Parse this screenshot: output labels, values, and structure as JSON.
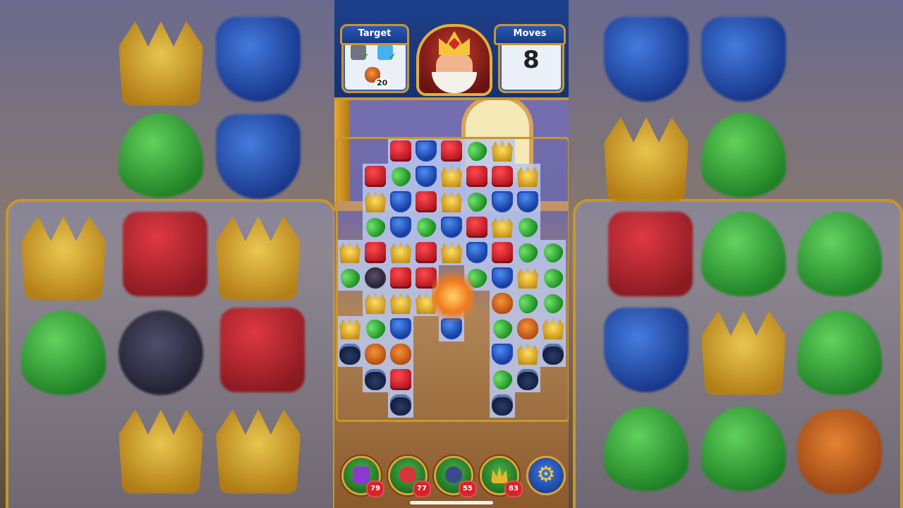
{
  "header": {
    "target_label": "Target",
    "moves_label": "Moves",
    "moves_value": "8",
    "target_pumpkin_count": "20"
  },
  "boosters": [
    {
      "name": "hammer-booster",
      "count": "79",
      "color": "#8a3ad0"
    },
    {
      "name": "arrow-booster",
      "count": "77",
      "color": "#d8343a"
    },
    {
      "name": "cannon-booster",
      "count": "55",
      "color": "#3a4a8a"
    },
    {
      "name": "jester-booster",
      "count": "83",
      "color": "#e6b62f"
    }
  ],
  "settings_icon": "gear-icon",
  "colors": {
    "accent_gold": "#c8962d",
    "topbar_blue": "#1e3f8a",
    "badge_red": "#d8232b"
  },
  "board_rows": [
    "..RBRGC..",
    ".RGBCRRC.",
    ".CBRCGBB.",
    ".GBGBRCG.",
    "CRCRCBRGG",
    "GXRR.GBCG",
    ".CCCC.PGGP",
    "CGB.B.GPC",
    "OPP...BCO",
    ".OR...GO.",
    "..O...O.."
  ]
}
